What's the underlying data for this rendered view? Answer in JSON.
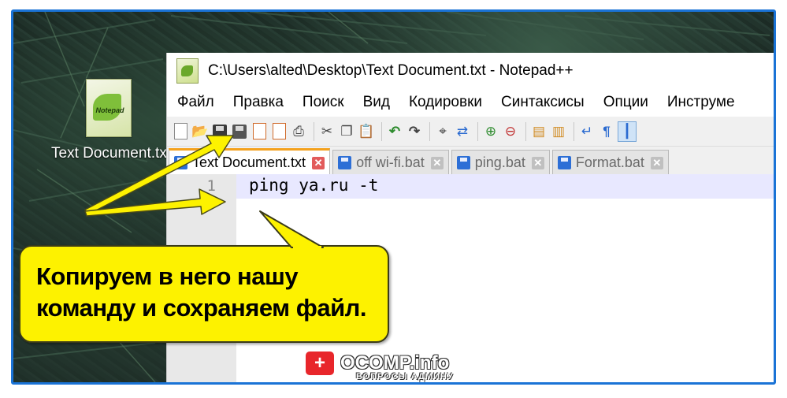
{
  "desktop": {
    "icon_label": "Text Document.txt"
  },
  "notepad": {
    "title": "C:\\Users\\alted\\Desktop\\Text Document.txt - Notepad++",
    "menu": [
      "Файл",
      "Правка",
      "Поиск",
      "Вид",
      "Кодировки",
      "Синтаксисы",
      "Опции",
      "Инструме"
    ],
    "tabs": [
      {
        "label": "Text Document.txt",
        "active": true
      },
      {
        "label": "off wi-fi.bat",
        "active": false
      },
      {
        "label": "ping.bat",
        "active": false
      },
      {
        "label": "Format.bat",
        "active": false
      }
    ],
    "editor": {
      "line_number": "1",
      "line_text": "ping ya.ru -t"
    }
  },
  "callout": {
    "line1": "Копируем в него нашу",
    "line2": "команду и сохраняем файл."
  },
  "watermark": {
    "brand": "OCOMP.info",
    "subtitle": "ВОПРОСЫ АДМИНУ",
    "badge_glyph": "+"
  },
  "colors": {
    "frame": "#1a73d6",
    "callout_fill": "#fdf200",
    "active_tab_accent": "#f4a11c",
    "current_line": "#e8e8ff"
  }
}
